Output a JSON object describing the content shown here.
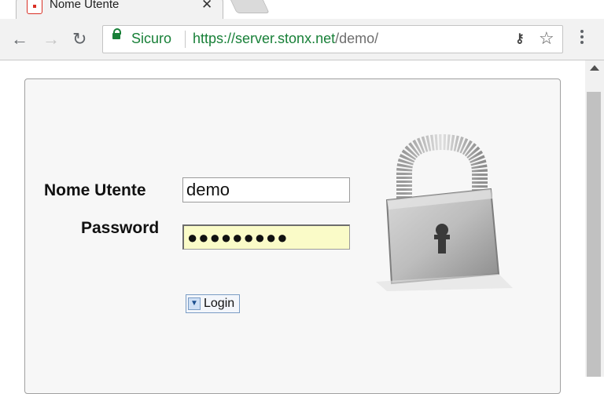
{
  "browser": {
    "tab": {
      "title": "Nome Utente"
    },
    "address": {
      "secure_label": "Sicuro",
      "url_host": "https://server.stonx.net",
      "url_path": "/demo/"
    }
  },
  "login_form": {
    "username_label": "Nome Utente",
    "username_value": "demo",
    "password_label": "Password",
    "password_masked": "●●●●●●●●●",
    "login_button_label": "Login"
  },
  "colors": {
    "secure_green": "#188038",
    "password_field_bg": "#fafbc8",
    "panel_bg": "#f7f7f7"
  },
  "icons": [
    "tab-favicon-icon",
    "close-icon",
    "back-arrow-icon",
    "forward-arrow-icon",
    "reload-icon",
    "lock-icon",
    "key-icon",
    "star-icon",
    "menu-dots-icon",
    "padlock-icon",
    "chevron-down-icon"
  ]
}
